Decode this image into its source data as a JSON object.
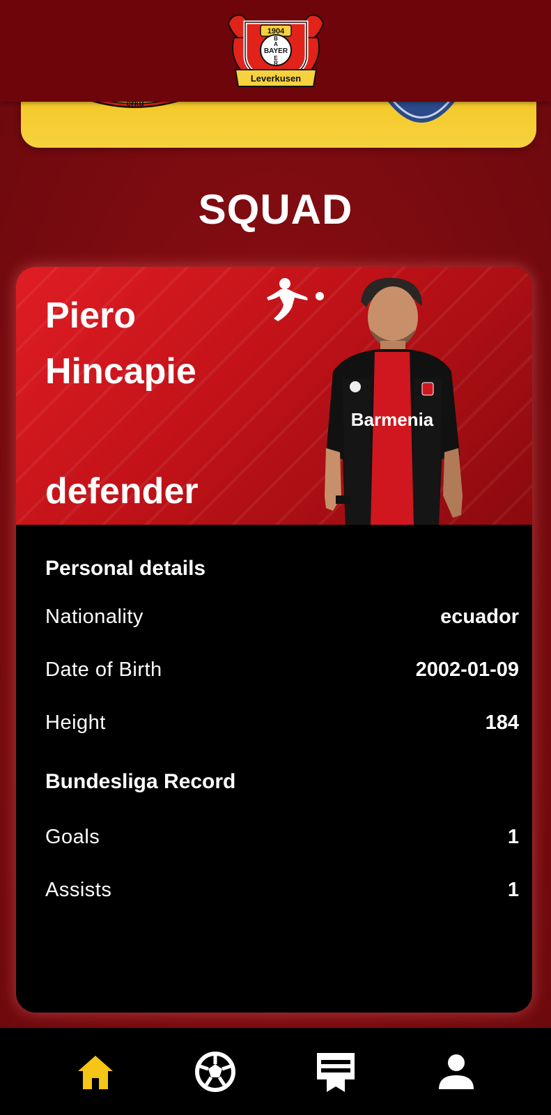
{
  "header": {
    "logo_text": {
      "year": "1904",
      "wordmark": "BAYER",
      "name": "Leverkusen"
    },
    "colors": {
      "bar": "#6e050a",
      "logo_red": "#e2231a",
      "logo_yellow": "#f7d23e"
    }
  },
  "match_banner": {
    "left_crest_icon": "leverkusen-crest-icon",
    "right_crest_icon": "opponent-crest-icon",
    "color": "#f2c21c"
  },
  "section": {
    "title": "SQUAD"
  },
  "player": {
    "name": "Piero Hincapie",
    "position": "defender",
    "league_icon": "bundesliga-icon",
    "personal_heading": "Personal details",
    "details": [
      {
        "label": "Nationality",
        "value": "ecuador"
      },
      {
        "label": "Date of Birth",
        "value": "2002-01-09"
      },
      {
        "label": "Height",
        "value": "184"
      }
    ],
    "record_heading": "Bundesliga Record",
    "record": [
      {
        "label": "Goals",
        "value": "1"
      },
      {
        "label": "Assists",
        "value": "1"
      }
    ],
    "shirt_sponsor": "Barmenia"
  },
  "bottom_nav": {
    "items": [
      {
        "icon": "home-icon",
        "active": true
      },
      {
        "icon": "football-icon",
        "active": false
      },
      {
        "icon": "scoreboard-icon",
        "active": false
      },
      {
        "icon": "profile-icon",
        "active": false
      }
    ],
    "active_color": "#f5c518",
    "inactive_color": "#ffffff"
  }
}
